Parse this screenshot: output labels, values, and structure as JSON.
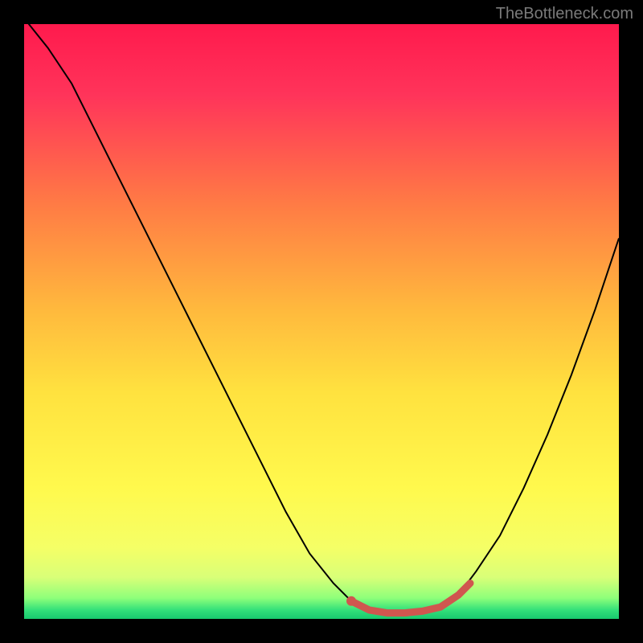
{
  "watermark": "TheBottleneck.com",
  "chart_data": {
    "type": "line",
    "title": "",
    "xlabel": "",
    "ylabel": "",
    "xlim": [
      0,
      100
    ],
    "ylim": [
      0,
      100
    ],
    "x": [
      0,
      4,
      8,
      12,
      16,
      20,
      24,
      28,
      32,
      36,
      40,
      44,
      48,
      52,
      55,
      58,
      61,
      64,
      67,
      70,
      73,
      76,
      80,
      84,
      88,
      92,
      96,
      100
    ],
    "values": [
      101,
      96,
      90,
      82,
      74,
      66,
      58,
      50,
      42,
      34,
      26,
      18,
      11,
      6,
      3,
      1.5,
      1,
      1,
      1.3,
      2,
      4,
      8,
      14,
      22,
      31,
      41,
      52,
      64
    ],
    "series": [
      {
        "name": "bottleneck-curve",
        "color": "#000000",
        "stroke_width": 2
      }
    ],
    "gradient_stops": [
      {
        "offset": 0.0,
        "color": "#ff1a4d"
      },
      {
        "offset": 0.12,
        "color": "#ff345a"
      },
      {
        "offset": 0.3,
        "color": "#ff7a45"
      },
      {
        "offset": 0.48,
        "color": "#ffb93d"
      },
      {
        "offset": 0.62,
        "color": "#ffe23f"
      },
      {
        "offset": 0.78,
        "color": "#fff94d"
      },
      {
        "offset": 0.88,
        "color": "#f5ff66"
      },
      {
        "offset": 0.93,
        "color": "#d9ff78"
      },
      {
        "offset": 0.965,
        "color": "#8eff7a"
      },
      {
        "offset": 0.985,
        "color": "#33e07a"
      },
      {
        "offset": 1.0,
        "color": "#18c96e"
      }
    ],
    "marker_segment": {
      "color": "#d0564f",
      "stroke_width": 9,
      "points_x": [
        55,
        58,
        61,
        64,
        67,
        70,
        73,
        75
      ],
      "points_y": [
        3,
        1.5,
        1,
        1,
        1.3,
        2,
        4,
        6
      ]
    },
    "marker_dot": {
      "color": "#d0564f",
      "radius": 6,
      "x": 55,
      "y": 3
    }
  }
}
